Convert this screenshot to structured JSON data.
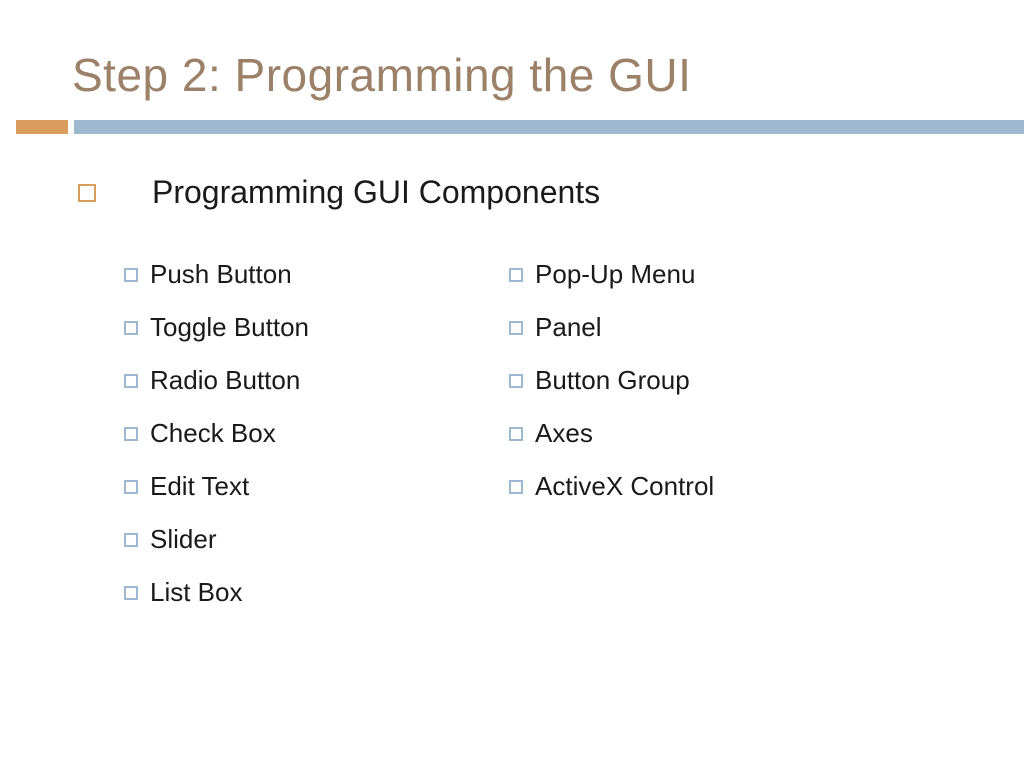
{
  "title": "Step 2: Programming the GUI",
  "subtitle": "Programming GUI  Components",
  "leftColumn": [
    "Push Button",
    "Toggle Button",
    "Radio Button",
    "Check Box",
    "Edit Text",
    "Slider",
    "List Box"
  ],
  "rightColumn": [
    "Pop-Up Menu",
    "Panel",
    "Button Group",
    "Axes",
    "ActiveX Control"
  ]
}
